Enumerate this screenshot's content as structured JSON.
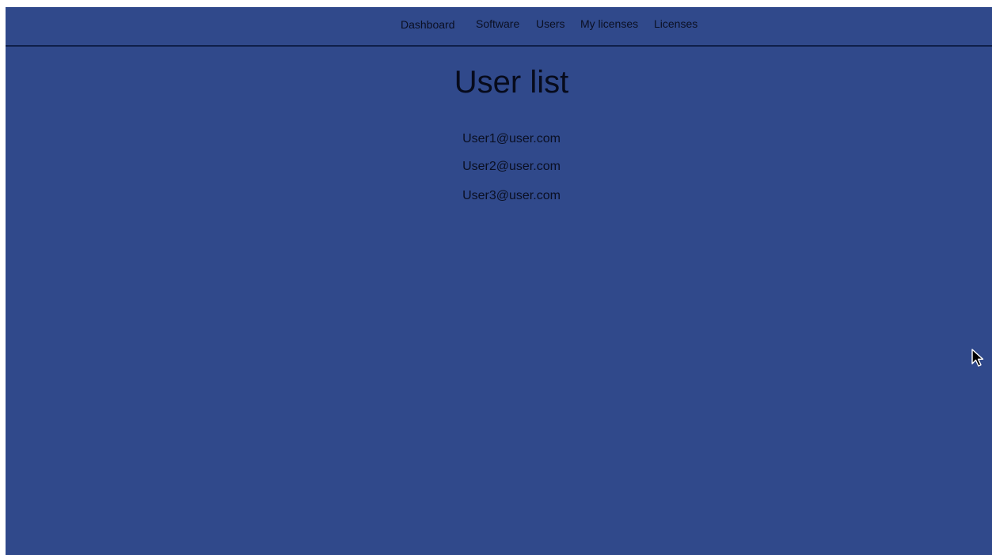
{
  "nav": {
    "items": [
      {
        "label": "Dashboard"
      },
      {
        "label": "Software"
      },
      {
        "label": "Users"
      },
      {
        "label": "My licenses"
      },
      {
        "label": "Licenses"
      }
    ]
  },
  "page": {
    "title": "User list"
  },
  "users": [
    {
      "email": "User1@user.com"
    },
    {
      "email": "User2@user.com"
    },
    {
      "email": "User3@user.com"
    }
  ],
  "colors": {
    "background": "#30498b",
    "text": "#0a0f22",
    "divider": "#0f1f4a"
  },
  "icons": {
    "cursor": "mouse-pointer-icon"
  }
}
